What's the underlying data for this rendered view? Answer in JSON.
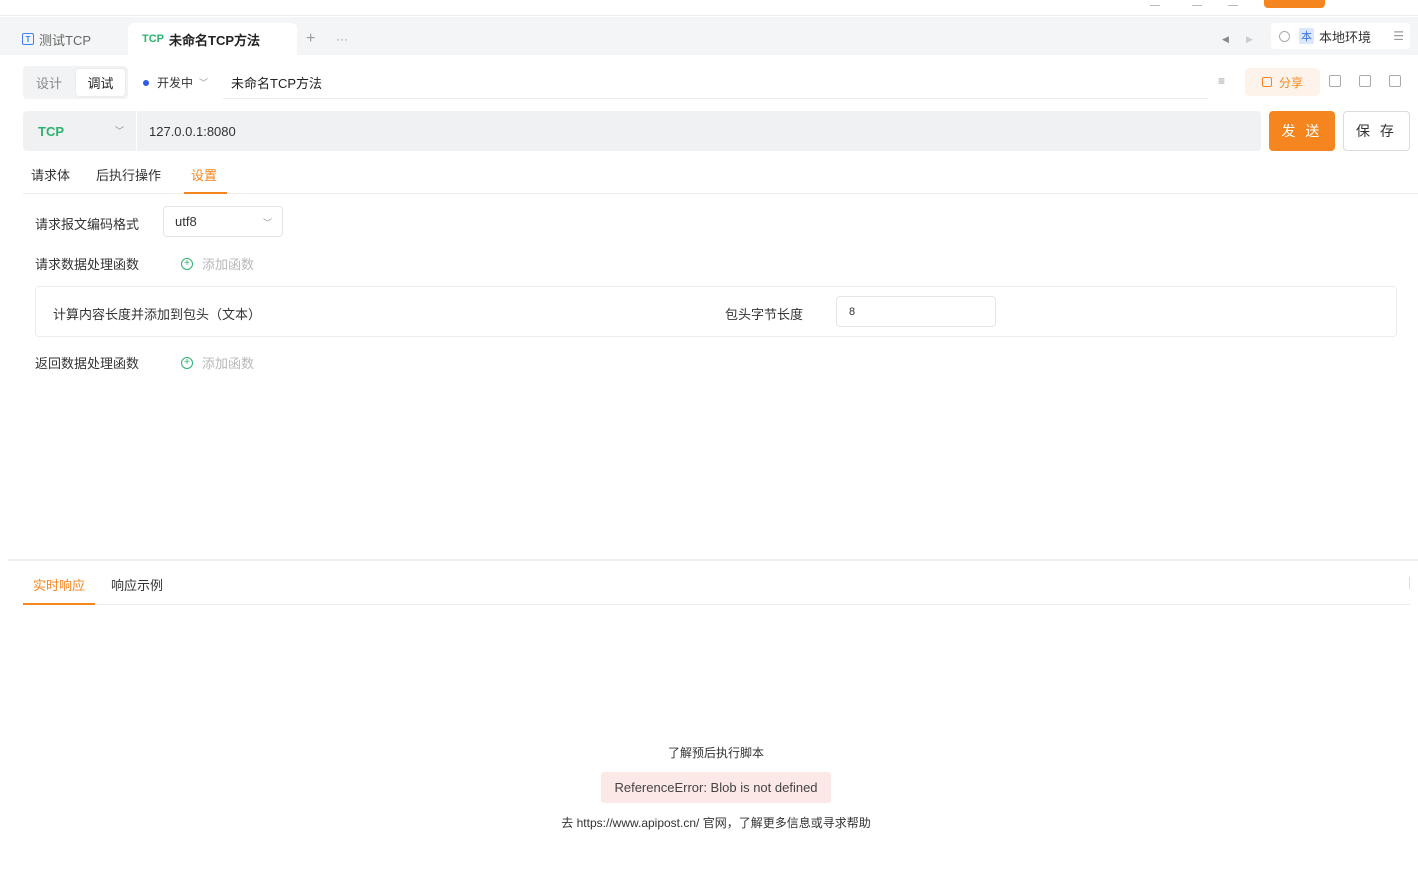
{
  "tabs": [
    {
      "icon": "T",
      "label": "测试TCP"
    },
    {
      "protocol": "TCP",
      "label": "未命名TCP方法"
    }
  ],
  "tabbar": {
    "add": "+",
    "more": "···"
  },
  "environment": {
    "badge": "本",
    "name": "本地环境"
  },
  "mode": {
    "design": "设计",
    "debug": "调试"
  },
  "status": {
    "label": "开发中",
    "color": "#2f5be6"
  },
  "method_name": "未命名TCP方法",
  "share_label": "分享",
  "request": {
    "protocol": "TCP",
    "url": "127.0.0.1:8080",
    "send_label": "发 送",
    "save_label": "保 存"
  },
  "sub_tabs": [
    "请求体",
    "后执行操作",
    "设置"
  ],
  "settings": {
    "encoding_label": "请求报文编码格式",
    "encoding_value": "utf8",
    "request_func_label": "请求数据处理函数",
    "add_func_label": "添加函数",
    "func_name": "计算内容长度并添加到包头（文本）",
    "header_len_label": "包头字节长度",
    "header_len_value": "8",
    "response_func_label": "返回数据处理函数"
  },
  "response": {
    "tabs": [
      "实时响应",
      "响应示例"
    ],
    "learn_link": "了解预后执行脚本",
    "error": "ReferenceError: Blob is not defined",
    "help": "去 https://www.apipost.cn/ 官网，了解更多信息或寻求帮助"
  },
  "colors": {
    "accent": "#f5861f",
    "tcp_green": "#2bb36c"
  }
}
